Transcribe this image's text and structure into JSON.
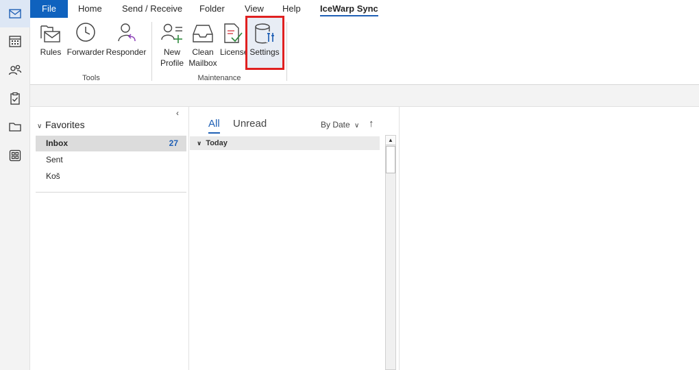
{
  "rail": {
    "items": [
      {
        "name": "mail-icon"
      },
      {
        "name": "calendar-icon"
      },
      {
        "name": "people-icon"
      },
      {
        "name": "tasks-icon"
      },
      {
        "name": "folder-icon"
      },
      {
        "name": "apps-icon"
      }
    ]
  },
  "tabs": {
    "file": "File",
    "home": "Home",
    "send_receive": "Send / Receive",
    "folder": "Folder",
    "view": "View",
    "help": "Help",
    "icewarp_sync": "IceWarp Sync"
  },
  "ribbon": {
    "tools": {
      "label": "Tools",
      "rules": "Rules",
      "forwarder": "Forwarder",
      "responder": "Responder"
    },
    "maintenance": {
      "label": "Maintenance",
      "new_profile_line1": "New",
      "new_profile_line2": "Profile",
      "clean_mailbox_line1": "Clean",
      "clean_mailbox_line2": "Mailbox",
      "license": "License",
      "settings": "Settings"
    },
    "colors": {
      "highlight": "#e02020",
      "accent": "#1e5fb5",
      "file_tab": "#0f62be"
    }
  },
  "folders": {
    "collapse_glyph": "‹",
    "favorites_label": "Favorites",
    "items": [
      {
        "label": "Inbox",
        "count": "27"
      },
      {
        "label": "Sent"
      },
      {
        "label": "Koš"
      }
    ]
  },
  "messages": {
    "filter_all": "All",
    "filter_unread": "Unread",
    "sort_by": "By Date",
    "sort_direction_glyph": "↑",
    "group_today": "Today"
  }
}
